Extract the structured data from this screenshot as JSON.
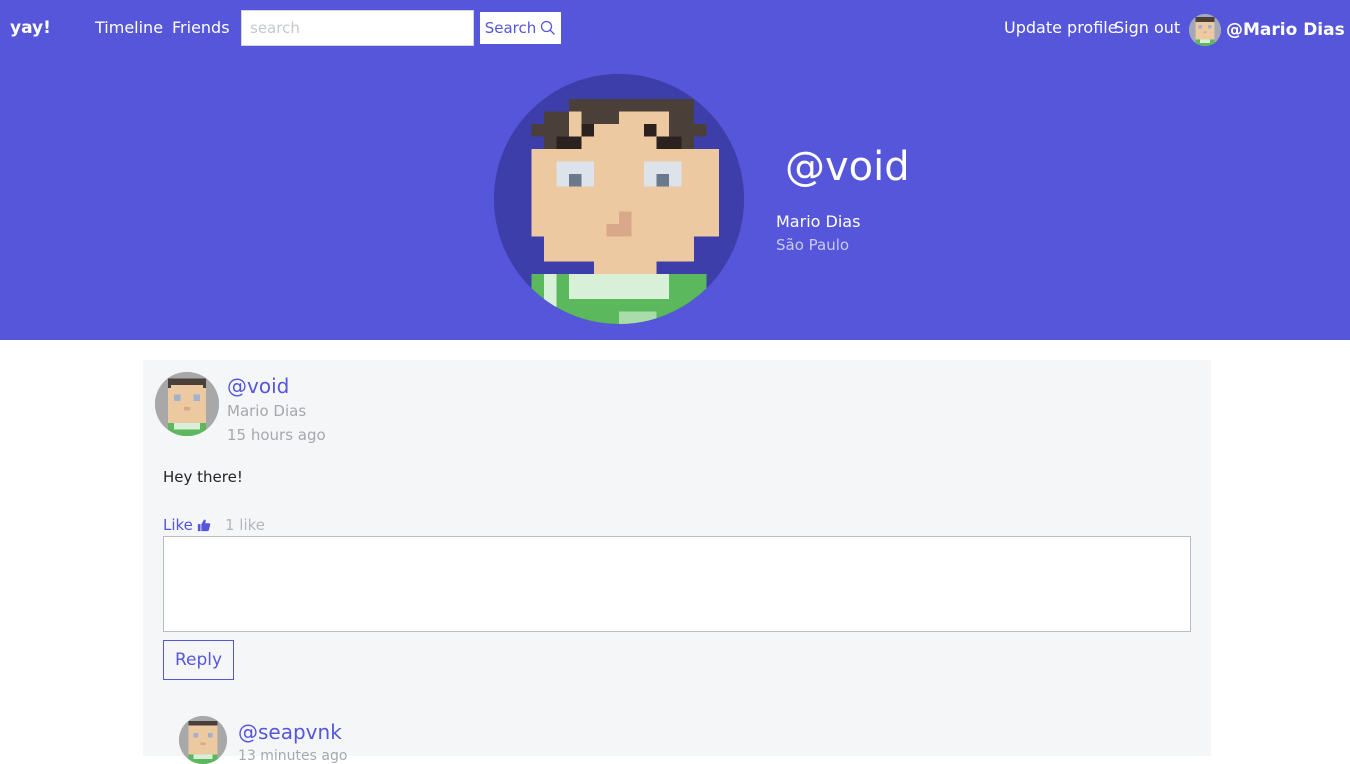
{
  "navbar": {
    "brand": "yay!",
    "links": {
      "timeline": "Timeline",
      "friends": "Friends"
    },
    "search": {
      "placeholder": "search",
      "value": "",
      "button_label": "Search"
    },
    "update_profile": "Update profile",
    "sign_out": "Sign out",
    "current_user": "@Mario Dias"
  },
  "profile": {
    "handle": "@void",
    "name": "Mario Dias",
    "city": "São Paulo"
  },
  "post": {
    "handle": "@void",
    "author": "Mario Dias",
    "time": "15 hours ago",
    "body": "Hey there!",
    "like_label": "Like",
    "like_count": "1 like",
    "reply_value": "",
    "reply_button": "Reply"
  },
  "replies": [
    {
      "handle": "@seapvnk",
      "time": "13 minutes ago"
    }
  ],
  "colors": {
    "brand": "#5656db",
    "card_bg": "#f5f6f8",
    "muted_text": "#a5a8ad"
  },
  "icons": {
    "search": "search-icon",
    "like": "thumbs-up-icon"
  }
}
